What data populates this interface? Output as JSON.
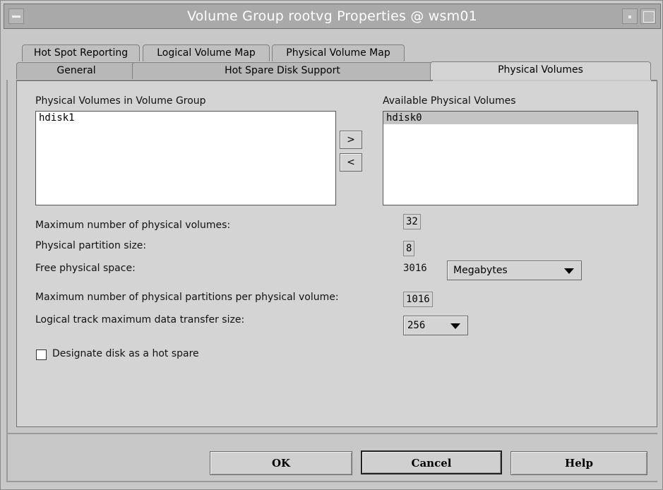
{
  "window": {
    "title": "Volume Group rootvg Properties @ wsm01"
  },
  "tabs": {
    "row_back": [
      {
        "label": "Hot Spot Reporting"
      },
      {
        "label": "Logical Volume Map"
      },
      {
        "label": "Physical Volume Map"
      }
    ],
    "row_front": [
      {
        "label": "General"
      },
      {
        "label": "Hot Spare Disk Support"
      },
      {
        "label": "Physical Volumes",
        "active": true
      }
    ]
  },
  "physical_volumes": {
    "in_group_label": "Physical Volumes in Volume Group",
    "in_group_items": [
      "hdisk1"
    ],
    "available_label": "Available Physical Volumes",
    "available_items": [
      "hdisk0"
    ],
    "add_label": ">",
    "remove_label": "<"
  },
  "properties": {
    "max_pv_label": "Maximum number of physical volumes:",
    "max_pv_value": "32",
    "pp_size_label": "Physical partition size:",
    "pp_size_value": "8",
    "free_space_label": "Free physical space:",
    "free_space_value": "3016",
    "free_space_unit": "Megabytes",
    "max_pp_per_pv_label": "Maximum number of physical partitions per physical volume:",
    "max_pp_per_pv_value": "1016",
    "ltg_label": "Logical track maximum data transfer size:",
    "ltg_value": "256",
    "hot_spare_label": "Designate disk as a hot spare",
    "hot_spare_checked": false
  },
  "buttons": {
    "ok": "OK",
    "cancel": "Cancel",
    "help": "Help"
  },
  "colors": {
    "window_bg": "#c8c8c8",
    "titlebar_bg": "#a9a9a9",
    "selected_item": "#c4c4c4"
  }
}
